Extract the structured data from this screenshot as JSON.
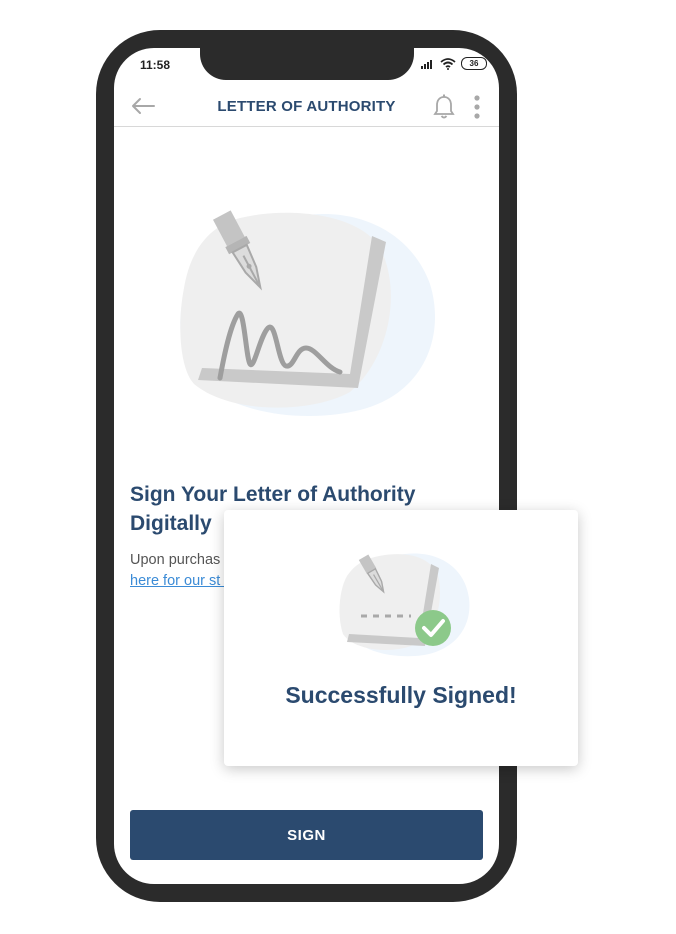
{
  "status_bar": {
    "time": "11:58",
    "battery": "36"
  },
  "header": {
    "title": "LETTER OF AUTHORITY"
  },
  "content": {
    "heading": "Sign Your Letter of Authority Digitally",
    "body_text": "Upon purchas time, you're re Authority' onc",
    "body_link": "here for our st signing."
  },
  "sign_button": {
    "label": "SIGN"
  },
  "popup": {
    "title": "Successfully Signed!"
  },
  "colors": {
    "brand": "#2b4a6f",
    "link": "#3b8bd6",
    "success": "#8cc98a"
  }
}
